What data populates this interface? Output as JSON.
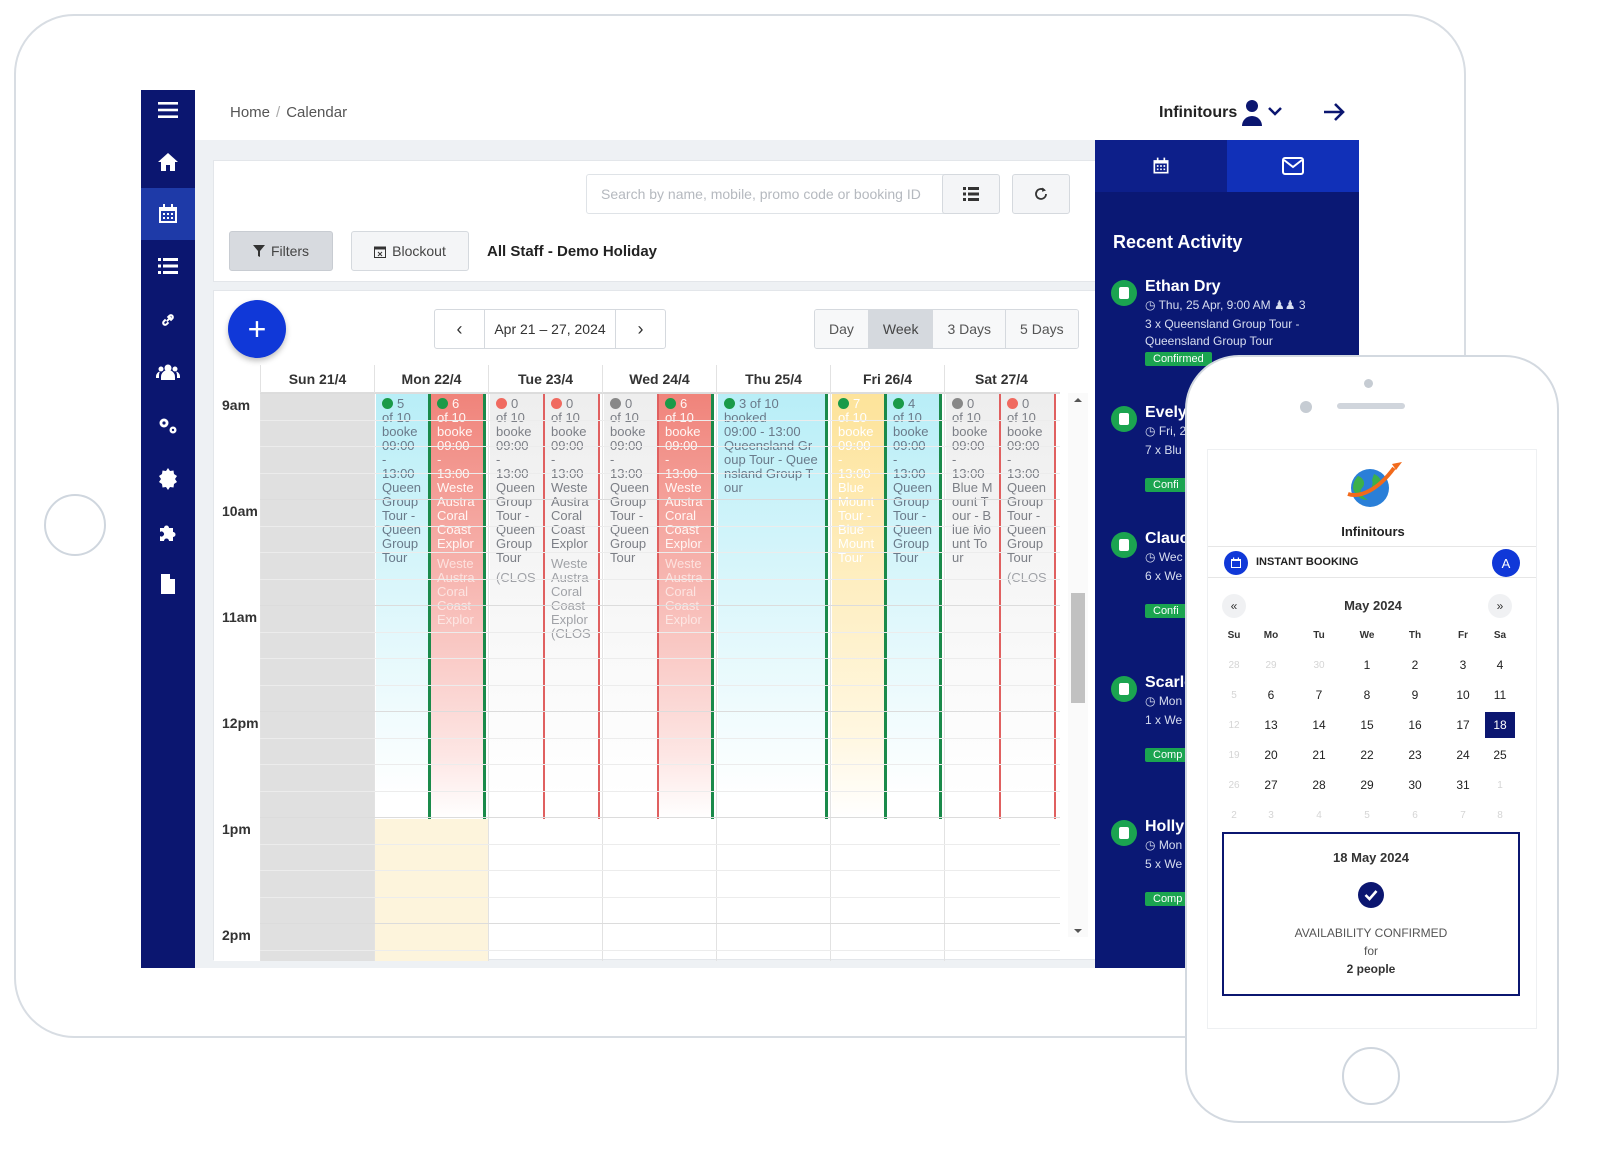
{
  "breadcrumb": {
    "home": "Home",
    "sep": "/",
    "current": "Calendar"
  },
  "brand": "Infinitours",
  "toolbar": {
    "search_placeholder": "Search by name, mobile, promo code or booking ID",
    "filters_label": "Filters",
    "blockout_label": "Blockout",
    "staff_label": "All Staff - Demo Holiday"
  },
  "calendar": {
    "range": "Apr 21 – 27, 2024",
    "views": [
      "Day",
      "Week",
      "3 Days",
      "5 Days"
    ],
    "active_view": "Week",
    "days": [
      "Sun 21/4",
      "Mon 22/4",
      "Tue 23/4",
      "Wed 24/4",
      "Thu 25/4",
      "Fri 26/4",
      "Sat 27/4"
    ],
    "times": [
      "9am",
      "10am",
      "11am",
      "12pm",
      "1pm",
      "2pm"
    ],
    "events": [
      {
        "count": "5",
        "of": "of 10",
        "status": "booke",
        "time1": "09:00",
        "dash": "-",
        "time2": "13:00",
        "desc": "Queen Group Tour - Queen Group Tour",
        "extra": "",
        "style": "blue",
        "dot": "#1a9a48"
      },
      {
        "count": "6",
        "of": "of 10",
        "status": "booke",
        "time1": "09:00",
        "dash": "-",
        "time2": "13:00",
        "desc": "Weste Austra Coral Coast Explor",
        "extra": "Weste Austra Coral Coast Explor",
        "style": "red",
        "dot": "#1a9a48"
      },
      {
        "count": "0",
        "of": "of 10",
        "status": "booke",
        "time1": "09:00",
        "dash": "-",
        "time2": "13:00",
        "desc": "Queen Group Tour - Queen Group Tour",
        "extra": "(CLOS",
        "style": "grey",
        "dot": "#f06a60"
      },
      {
        "count": "0",
        "of": "of 10",
        "status": "booke",
        "time1": "09:00",
        "dash": "-",
        "time2": "13:00",
        "desc": "Weste Austra Coral Coast Explor",
        "extra": "Weste Austra Coral Coast Explor (CLOS",
        "style": "grey",
        "dot": "#f06a60"
      },
      {
        "count": "0",
        "of": "of 10",
        "status": "booke",
        "time1": "09:00",
        "dash": "-",
        "time2": "13:00",
        "desc": "Queen Group Tour - Queen Group Tour",
        "extra": "",
        "style": "grey",
        "dot": "#888888"
      },
      {
        "count": "6",
        "of": "of 10",
        "status": "booke",
        "time1": "09:00",
        "dash": "-",
        "time2": "13:00",
        "desc": "Weste Austra Coral Coast Explor",
        "extra": "Weste Austra Coral Coast Explor",
        "style": "red",
        "dot": "#1a9a48"
      },
      {
        "count": "3 of 10",
        "of": "",
        "status": "booked",
        "time1": "09:00 - 13:00",
        "dash": "",
        "time2": "",
        "desc": "Queensland Group Tour - Queensland Group Tour",
        "extra": "",
        "style": "blue",
        "dot": "#1a9a48"
      },
      {
        "count": "7",
        "of": "of 10",
        "status": "booke",
        "time1": "09:00",
        "dash": "-",
        "time2": "13:00",
        "desc": "Blue Mount Tour - Blue Mount Tour",
        "extra": "",
        "style": "yel",
        "dot": "#1a9a48"
      },
      {
        "count": "4",
        "of": "of 10",
        "status": "booke",
        "time1": "09:00",
        "dash": "-",
        "time2": "13:00",
        "desc": "Queen Group Tour - Queen Group Tour",
        "extra": "",
        "style": "blue",
        "dot": "#1a9a48"
      },
      {
        "count": "0",
        "of": "of 10",
        "status": "booke",
        "time1": "09:00",
        "dash": "-",
        "time2": "13:00",
        "desc": "Blue Mount Tour - Blue Mount Tour",
        "extra": "",
        "style": "grey",
        "dot": "#888888"
      },
      {
        "count": "0",
        "of": "of 10",
        "status": "booke",
        "time1": "09:00",
        "dash": "-",
        "time2": "13:00",
        "desc": "Queen Group Tour - Queen Group Tour",
        "extra": "(CLOS",
        "style": "grey",
        "dot": "#f06a60"
      }
    ]
  },
  "recent_activity": {
    "title": "Recent Activity",
    "items": [
      {
        "name": "Ethan Dry",
        "when": "Thu, 25 Apr, 9:00 AM",
        "pax": "3",
        "desc": "3 x Queensland Group Tour - Queensland Group Tour",
        "status": "Confirmed"
      },
      {
        "name": "Evely",
        "when": "Fri, 2",
        "pax": "",
        "desc": "7 x Blu Mount",
        "status": "Confi"
      },
      {
        "name": "Clauc",
        "when": "Wec",
        "pax": "",
        "desc": "6 x We Coast Austra",
        "status": "Confi"
      },
      {
        "name": "Scarle",
        "when": "Mon",
        "pax": "",
        "desc": "1 x We Coast E Austral",
        "status": "Comp"
      },
      {
        "name": "Holly",
        "when": "Mon",
        "pax": "",
        "desc": "5 x We Coast E Austral",
        "status": "Comp"
      }
    ]
  },
  "phone": {
    "brand": "Infinitours",
    "instant_booking": "INSTANT BOOKING",
    "avatar": "A",
    "prev": "«",
    "next": "»",
    "month": "May 2024",
    "dow": [
      "Su",
      "Mo",
      "Tu",
      "We",
      "Th",
      "Fr",
      "Sa"
    ],
    "weeks": [
      [
        "28",
        "29",
        "30",
        "1",
        "2",
        "3",
        "4"
      ],
      [
        "5",
        "6",
        "7",
        "8",
        "9",
        "10",
        "11"
      ],
      [
        "12",
        "13",
        "14",
        "15",
        "16",
        "17",
        "18"
      ],
      [
        "19",
        "20",
        "21",
        "22",
        "23",
        "24",
        "25"
      ],
      [
        "26",
        "27",
        "28",
        "29",
        "30",
        "31",
        "1"
      ],
      [
        "2",
        "3",
        "4",
        "5",
        "6",
        "7",
        "8"
      ]
    ],
    "muted": [
      [
        1,
        1,
        1,
        0,
        0,
        0,
        0
      ],
      [
        1,
        0,
        0,
        0,
        0,
        0,
        0
      ],
      [
        1,
        0,
        0,
        0,
        0,
        0,
        0
      ],
      [
        1,
        0,
        0,
        0,
        0,
        0,
        0
      ],
      [
        1,
        0,
        0,
        0,
        0,
        0,
        1
      ],
      [
        1,
        1,
        1,
        1,
        1,
        1,
        1
      ]
    ],
    "selected_day": "18",
    "confirm": {
      "date": "18 May 2024",
      "status": "AVAILABILITY CONFIRMED",
      "for": "for",
      "people": "2 people"
    }
  }
}
